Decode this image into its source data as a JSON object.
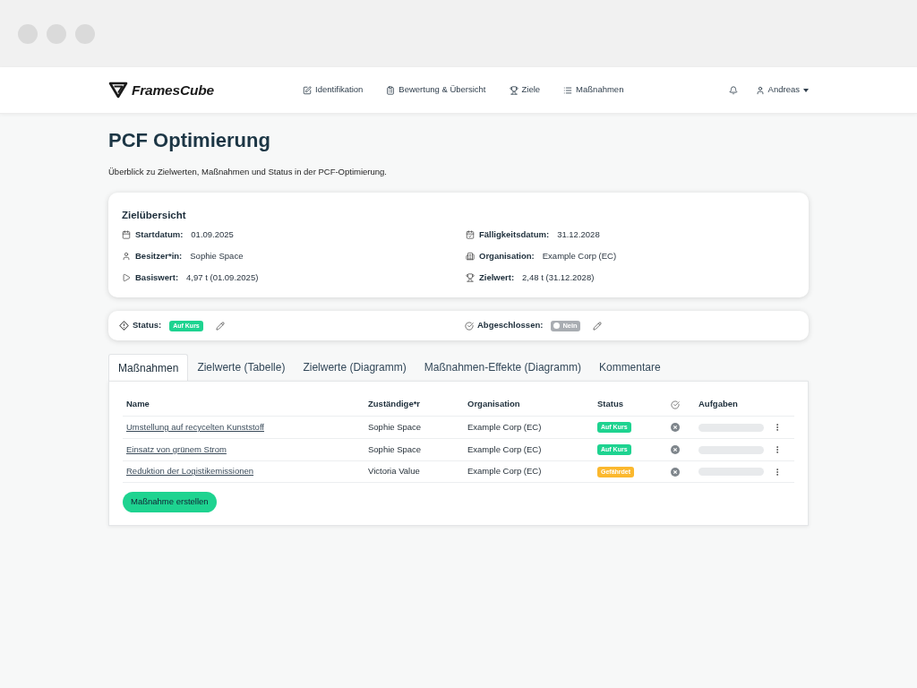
{
  "nav": {
    "brand": "FramesCube",
    "items": [
      {
        "label": "Identifikation"
      },
      {
        "label": "Bewertung & Übersicht"
      },
      {
        "label": "Ziele"
      },
      {
        "label": "Maßnahmen"
      }
    ],
    "user": "Andreas"
  },
  "page": {
    "title": "PCF Optimierung",
    "description": "Überblick zu Zielwerten, Maßnahmen und Status in der PCF-Optimierung."
  },
  "overview": {
    "title": "Zielübersicht",
    "fields": [
      {
        "label": "Startdatum:",
        "value": "01.09.2025"
      },
      {
        "label": "Fälligkeitsdatum:",
        "value": "31.12.2028"
      },
      {
        "label": "Besitzer*in:",
        "value": "Sophie Space"
      },
      {
        "label": "Organisation:",
        "value": "Example Corp (EC)"
      },
      {
        "label": "Basiswert:",
        "value": "4,97 t (01.09.2025)"
      },
      {
        "label": "Zielwert:",
        "value": "2,48 t (31.12.2028)"
      }
    ]
  },
  "status_bar": {
    "status": {
      "label": "Status:",
      "badge": "Auf Kurs",
      "color": "#1ed390"
    },
    "completed": {
      "label": "Abgeschlossen:",
      "toggle_text": "Nein",
      "on": false
    }
  },
  "tabs": [
    {
      "label": "Maßnahmen",
      "selected": true
    },
    {
      "label": "Zielwerte (Tabelle)",
      "selected": false
    },
    {
      "label": "Zielwerte (Diagramm)",
      "selected": false
    },
    {
      "label": "Maßnahmen-Effekte (Diagramm)",
      "selected": false
    },
    {
      "label": "Kommentare",
      "selected": false
    }
  ],
  "table": {
    "columns": [
      "Name",
      "Zuständige*r",
      "Organisation",
      "Status",
      "Aufgaben"
    ],
    "rows": [
      {
        "name": "Umstellung auf recycelten Kunststoff",
        "owner": "Sophie Space",
        "organisation": "Example Corp (EC)",
        "status": {
          "label": "Auf Kurs",
          "color": "#1ed390"
        },
        "completed": false
      },
      {
        "name": "Einsatz von grünem Strom",
        "owner": "Sophie Space",
        "organisation": "Example Corp (EC)",
        "status": {
          "label": "Auf Kurs",
          "color": "#1ed390"
        },
        "completed": false
      },
      {
        "name": "Reduktion der Logistikemissionen",
        "owner": "Victoria Value",
        "organisation": "Example Corp (EC)",
        "status": {
          "label": "Gefährdet",
          "color": "#fbb82e"
        },
        "completed": false
      }
    ]
  },
  "create_button": "Maßnahme erstellen"
}
